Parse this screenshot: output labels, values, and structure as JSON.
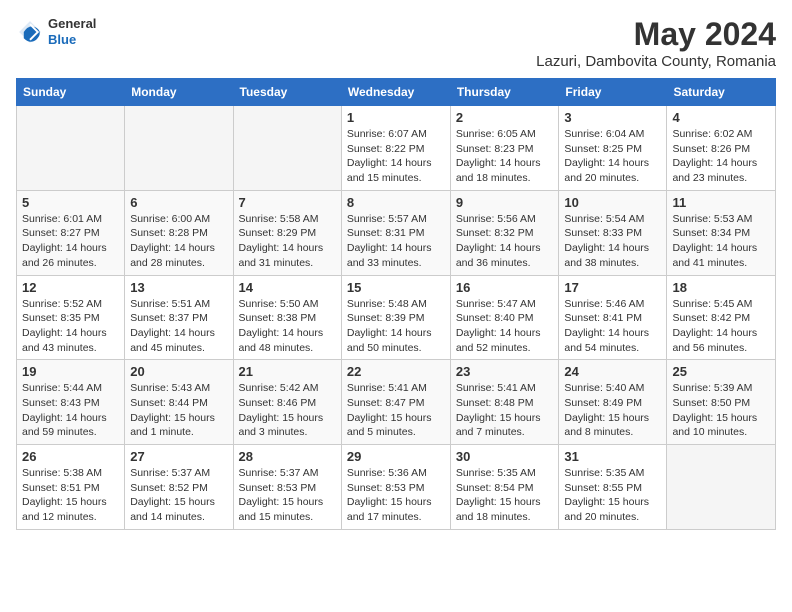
{
  "app": {
    "logo_general": "General",
    "logo_blue": "Blue",
    "month": "May 2024",
    "location": "Lazuri, Dambovita County, Romania"
  },
  "weekdays": [
    "Sunday",
    "Monday",
    "Tuesday",
    "Wednesday",
    "Thursday",
    "Friday",
    "Saturday"
  ],
  "weeks": [
    [
      {
        "day": "",
        "text": ""
      },
      {
        "day": "",
        "text": ""
      },
      {
        "day": "",
        "text": ""
      },
      {
        "day": "1",
        "text": "Sunrise: 6:07 AM\nSunset: 8:22 PM\nDaylight: 14 hours and 15 minutes."
      },
      {
        "day": "2",
        "text": "Sunrise: 6:05 AM\nSunset: 8:23 PM\nDaylight: 14 hours and 18 minutes."
      },
      {
        "day": "3",
        "text": "Sunrise: 6:04 AM\nSunset: 8:25 PM\nDaylight: 14 hours and 20 minutes."
      },
      {
        "day": "4",
        "text": "Sunrise: 6:02 AM\nSunset: 8:26 PM\nDaylight: 14 hours and 23 minutes."
      }
    ],
    [
      {
        "day": "5",
        "text": "Sunrise: 6:01 AM\nSunset: 8:27 PM\nDaylight: 14 hours and 26 minutes."
      },
      {
        "day": "6",
        "text": "Sunrise: 6:00 AM\nSunset: 8:28 PM\nDaylight: 14 hours and 28 minutes."
      },
      {
        "day": "7",
        "text": "Sunrise: 5:58 AM\nSunset: 8:29 PM\nDaylight: 14 hours and 31 minutes."
      },
      {
        "day": "8",
        "text": "Sunrise: 5:57 AM\nSunset: 8:31 PM\nDaylight: 14 hours and 33 minutes."
      },
      {
        "day": "9",
        "text": "Sunrise: 5:56 AM\nSunset: 8:32 PM\nDaylight: 14 hours and 36 minutes."
      },
      {
        "day": "10",
        "text": "Sunrise: 5:54 AM\nSunset: 8:33 PM\nDaylight: 14 hours and 38 minutes."
      },
      {
        "day": "11",
        "text": "Sunrise: 5:53 AM\nSunset: 8:34 PM\nDaylight: 14 hours and 41 minutes."
      }
    ],
    [
      {
        "day": "12",
        "text": "Sunrise: 5:52 AM\nSunset: 8:35 PM\nDaylight: 14 hours and 43 minutes."
      },
      {
        "day": "13",
        "text": "Sunrise: 5:51 AM\nSunset: 8:37 PM\nDaylight: 14 hours and 45 minutes."
      },
      {
        "day": "14",
        "text": "Sunrise: 5:50 AM\nSunset: 8:38 PM\nDaylight: 14 hours and 48 minutes."
      },
      {
        "day": "15",
        "text": "Sunrise: 5:48 AM\nSunset: 8:39 PM\nDaylight: 14 hours and 50 minutes."
      },
      {
        "day": "16",
        "text": "Sunrise: 5:47 AM\nSunset: 8:40 PM\nDaylight: 14 hours and 52 minutes."
      },
      {
        "day": "17",
        "text": "Sunrise: 5:46 AM\nSunset: 8:41 PM\nDaylight: 14 hours and 54 minutes."
      },
      {
        "day": "18",
        "text": "Sunrise: 5:45 AM\nSunset: 8:42 PM\nDaylight: 14 hours and 56 minutes."
      }
    ],
    [
      {
        "day": "19",
        "text": "Sunrise: 5:44 AM\nSunset: 8:43 PM\nDaylight: 14 hours and 59 minutes."
      },
      {
        "day": "20",
        "text": "Sunrise: 5:43 AM\nSunset: 8:44 PM\nDaylight: 15 hours and 1 minute."
      },
      {
        "day": "21",
        "text": "Sunrise: 5:42 AM\nSunset: 8:46 PM\nDaylight: 15 hours and 3 minutes."
      },
      {
        "day": "22",
        "text": "Sunrise: 5:41 AM\nSunset: 8:47 PM\nDaylight: 15 hours and 5 minutes."
      },
      {
        "day": "23",
        "text": "Sunrise: 5:41 AM\nSunset: 8:48 PM\nDaylight: 15 hours and 7 minutes."
      },
      {
        "day": "24",
        "text": "Sunrise: 5:40 AM\nSunset: 8:49 PM\nDaylight: 15 hours and 8 minutes."
      },
      {
        "day": "25",
        "text": "Sunrise: 5:39 AM\nSunset: 8:50 PM\nDaylight: 15 hours and 10 minutes."
      }
    ],
    [
      {
        "day": "26",
        "text": "Sunrise: 5:38 AM\nSunset: 8:51 PM\nDaylight: 15 hours and 12 minutes."
      },
      {
        "day": "27",
        "text": "Sunrise: 5:37 AM\nSunset: 8:52 PM\nDaylight: 15 hours and 14 minutes."
      },
      {
        "day": "28",
        "text": "Sunrise: 5:37 AM\nSunset: 8:53 PM\nDaylight: 15 hours and 15 minutes."
      },
      {
        "day": "29",
        "text": "Sunrise: 5:36 AM\nSunset: 8:53 PM\nDaylight: 15 hours and 17 minutes."
      },
      {
        "day": "30",
        "text": "Sunrise: 5:35 AM\nSunset: 8:54 PM\nDaylight: 15 hours and 18 minutes."
      },
      {
        "day": "31",
        "text": "Sunrise: 5:35 AM\nSunset: 8:55 PM\nDaylight: 15 hours and 20 minutes."
      },
      {
        "day": "",
        "text": ""
      }
    ]
  ]
}
